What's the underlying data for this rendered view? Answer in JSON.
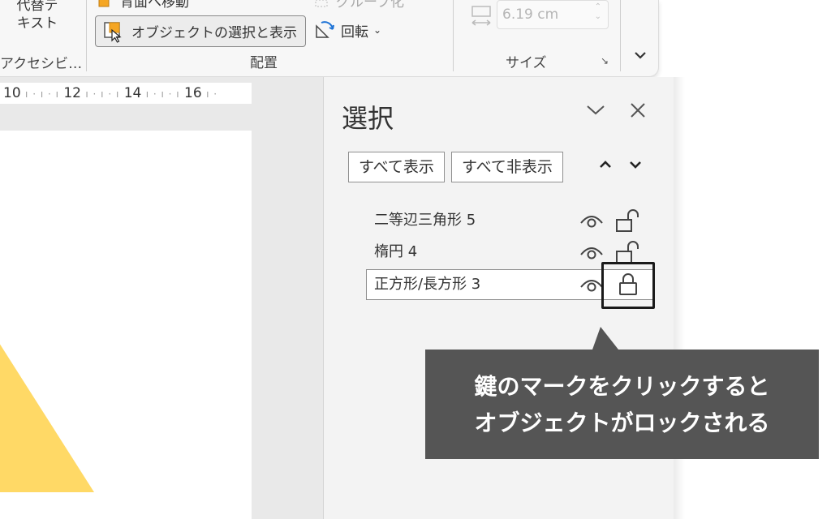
{
  "ribbon": {
    "alt_text_label": "代替テ\nキスト",
    "accessibility_label": "アクセシビ…",
    "move_backward_label": "背面へ移動",
    "selection_pane_label": "オブジェクトの選択と表示",
    "group_label": "グループ化",
    "rotate_label": "回転",
    "arrange_group_label": "配置",
    "width_value": "6.19 cm",
    "size_group_label": "サイズ"
  },
  "ruler": {
    "marks": [
      "10",
      "12",
      "14",
      "16"
    ]
  },
  "selection_pane": {
    "title": "選択",
    "show_all_label": "すべて表示",
    "hide_all_label": "すべて非表示",
    "objects": [
      {
        "name": "二等辺三角形 5",
        "locked": false,
        "selected": false
      },
      {
        "name": "楕円 4",
        "locked": false,
        "selected": false
      },
      {
        "name": "正方形/長方形 3",
        "locked": true,
        "selected": true
      }
    ]
  },
  "callout": {
    "line1": "鍵のマークをクリックすると",
    "line2": "オブジェクトがロックされる"
  },
  "colors": {
    "callout_bg": "#555555",
    "triangle_fill": "#ffd966",
    "pane_bg": "#f3f3f3"
  },
  "icons": [
    "picture-icon",
    "selection-pane-icon",
    "group-icon",
    "rotate-icon",
    "width-icon",
    "eye-icon",
    "unlocked-icon",
    "locked-icon",
    "chevron-down-icon",
    "close-icon"
  ]
}
